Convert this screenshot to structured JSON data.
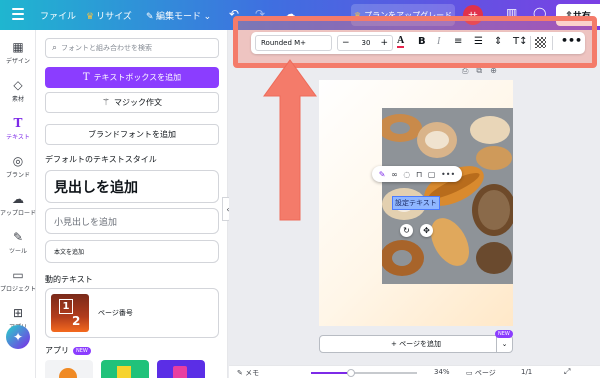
{
  "topbar": {
    "file": "ファイル",
    "resize": "リサイズ",
    "edit_mode": "編集モード",
    "upgrade": "プランをアップグレード",
    "avatar": "サ",
    "share": "共有"
  },
  "rail": {
    "design": "デザイン",
    "elements": "素材",
    "text": "テキスト",
    "brand": "ブランド",
    "upload": "アップロード",
    "tools": "ツール",
    "projects": "プロジェクト",
    "apps": "アプリ"
  },
  "panel": {
    "search_placeholder": "フォントと組み合わせを検索",
    "add_textbox": "テキストボックスを追加",
    "magic_write": "マジック作文",
    "brand_fonts": "ブランドフォントを追加",
    "default_styles_title": "デフォルトのテキストスタイル",
    "heading": "見出しを追加",
    "subheading": "小見出しを追加",
    "body": "本文を追加",
    "dynamic_title": "動的テキスト",
    "page_number": "ページ番号",
    "thumb_n1": "1",
    "thumb_n2": "2",
    "apps_title": "アプリ",
    "new_badge": "NEW"
  },
  "text_toolbar": {
    "font": "Rounded M+",
    "size": "30",
    "minus": "−",
    "plus": "+"
  },
  "canvas": {
    "selected_text": "設定テキスト",
    "add_page": "+ ページを追加",
    "new_badge": "NEW"
  },
  "bottombar": {
    "memo": "メモ",
    "zoom": "34%",
    "zoom_fraction": 0.34,
    "pages": "ページ",
    "count": "1/1"
  }
}
